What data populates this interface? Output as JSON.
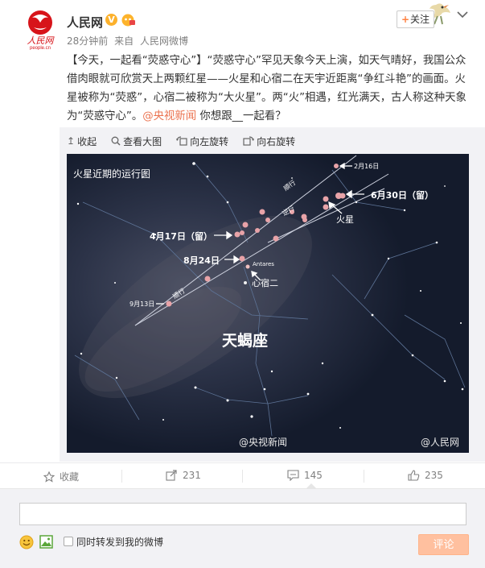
{
  "post": {
    "user_name": "人民网",
    "avatar_text": "人民网",
    "avatar_sub": "people.cn",
    "verified_mark": "V",
    "time": "28分钟前",
    "source_prefix": "来自",
    "source": "人民网微博",
    "follow_label": "关注",
    "text_main": "【今天，一起看“荧惑守心”】“荧惑守心”罕见天象今天上演，如天气晴好，我国公众借肉眼就可欣赏天上两颗红星——火星和心宿二在天宇近距离“争红斗艳”的画面。火星被称为“荧惑”，心宿二被称为“大火星”。两“火”相遇，红光满天，古人称这种天象为“荧惑守心”。",
    "mention": "@央视新闻",
    "text_tail": " 你想跟__一起看？"
  },
  "media_tools": {
    "collapse": "收起",
    "view_large": "查看大图",
    "rotate_left": "向左旋转",
    "rotate_right": "向右旋转"
  },
  "starmap": {
    "title": "火星近期的运行图",
    "labels": {
      "feb16": "2月16日",
      "jun30": "6月30日（留）",
      "apr17": "4月17日（留）",
      "aug24": "8月24日",
      "sep13": "9月13日",
      "shunxing_top": "顺行",
      "nixing": "逆行",
      "shunxing_bottom": "顺行",
      "mars": "火星",
      "antares_en": "Antares",
      "antares_cn": "心宿二",
      "constellation": "天蝎座",
      "watermark_left": "@央视新闻",
      "watermark_right": "@人民网"
    }
  },
  "actions": {
    "favorite": "收藏",
    "repost_count": "231",
    "comment_count": "145",
    "like_count": "235"
  },
  "comment_box": {
    "repost_label": "同时转发到我的微博",
    "submit": "评论"
  },
  "colors": {
    "accent": "#eb7350",
    "follow_plus": "#ff8140",
    "sky": "#1b2336",
    "submit_bg": "#ffc09f"
  }
}
